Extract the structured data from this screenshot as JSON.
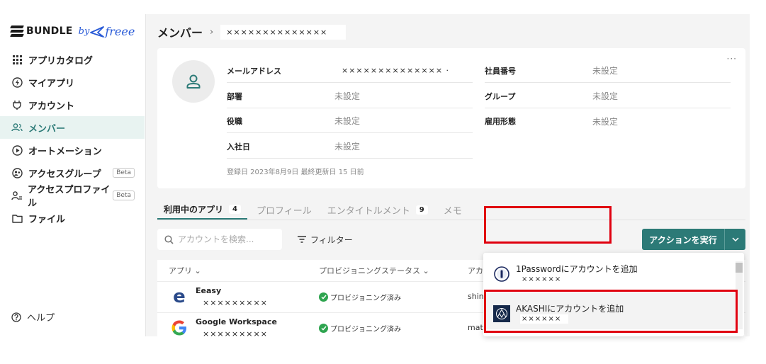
{
  "brand": {
    "name": "BUNDLE",
    "by": "by",
    "partner": "freee"
  },
  "sidebar": {
    "items": [
      {
        "label": "アプリカタログ",
        "icon": "grid-icon"
      },
      {
        "label": "マイアプリ",
        "icon": "bolt-icon"
      },
      {
        "label": "アカウント",
        "icon": "plug-icon"
      },
      {
        "label": "メンバー",
        "icon": "users-icon",
        "active": true
      },
      {
        "label": "オートメーション",
        "icon": "play-icon"
      },
      {
        "label": "アクセスグループ",
        "icon": "group-icon",
        "badge": "Beta"
      },
      {
        "label": "アクセスプロファイル",
        "icon": "profile-icon",
        "badge": "Beta"
      },
      {
        "label": "ファイル",
        "icon": "folder-icon"
      }
    ],
    "help": "ヘルプ"
  },
  "header": {
    "title": "メンバー",
    "member_name": "××××××××××××××"
  },
  "profile": {
    "fields": [
      {
        "label": "メールアドレス",
        "value": "×××××××××××××× ·"
      },
      {
        "label": "部署",
        "value": "未設定"
      },
      {
        "label": "役職",
        "value": "未設定"
      },
      {
        "label": "入社日",
        "value": "未設定"
      },
      {
        "label": "社員番号",
        "value": "未設定"
      },
      {
        "label": "グループ",
        "value": "未設定"
      },
      {
        "label": "雇用形態",
        "value": "未設定"
      }
    ],
    "meta": "登録日 2023年8月9日  最終更新日 15 日前",
    "more": "···"
  },
  "tabs": [
    {
      "label": "利用中のアプリ",
      "count": "4",
      "active": true
    },
    {
      "label": "プロフィール"
    },
    {
      "label": "エンタイトルメント",
      "count": "9"
    },
    {
      "label": "メモ"
    }
  ],
  "toolbar": {
    "search_placeholder": "アカウントを検索...",
    "filter_label": "フィルター",
    "action_label": "アクションを実行"
  },
  "table": {
    "headers": [
      "アプリ",
      "プロビジョニングステータス",
      "アカ"
    ],
    "rows": [
      {
        "app": "Eeasy",
        "account": "×××××××××",
        "status": "プロビジョニング済み",
        "account_col": "shin"
      },
      {
        "app": "Google Workspace",
        "account": "×××××××××",
        "status": "プロビジョニング済み",
        "account_col": "mat"
      }
    ]
  },
  "dropdown": {
    "items": [
      {
        "label": "1Passwordにアカウントを追加",
        "sub": "××××××"
      },
      {
        "label": "AKASHIにアカウントを追加",
        "sub": "××××××"
      }
    ]
  },
  "colors": {
    "accent": "#2c7a77",
    "highlight": "#e0000f",
    "success": "#2ea44f"
  }
}
